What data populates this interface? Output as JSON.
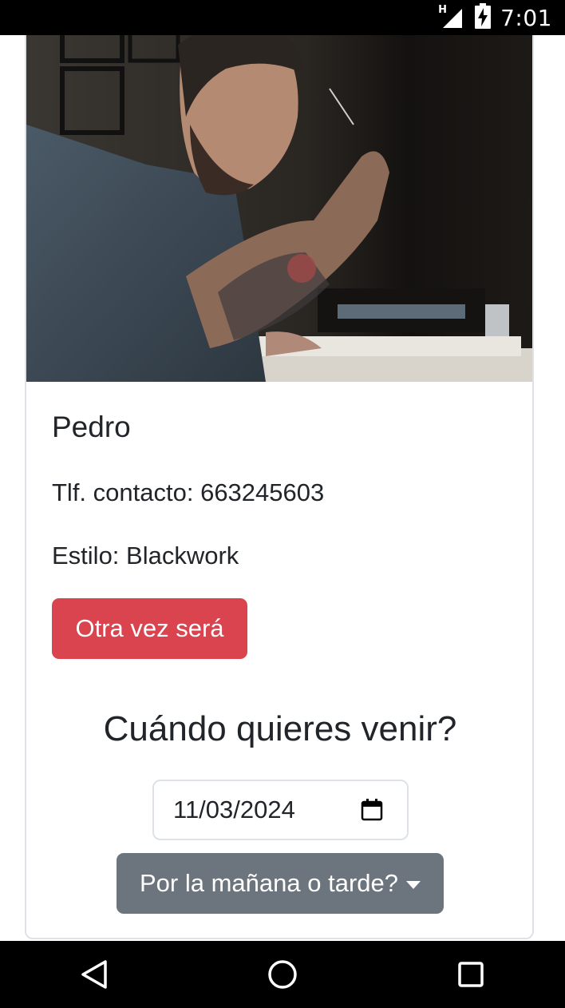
{
  "status_bar": {
    "network_type": "H",
    "time": "7:01",
    "icons": [
      "signal-icon",
      "battery-charging-icon"
    ]
  },
  "card": {
    "image_alt": "tattoo-artist-photo",
    "name": "Pedro",
    "phone": "Tlf. contacto: 663245603",
    "style": "Estilo: Blackwork",
    "cancel_button": "Otra vez será",
    "question": "Cuándo quieres venir?",
    "date_value": "11/03/2024",
    "dropdown_label": "Por la mañana o tarde?"
  },
  "colors": {
    "danger": "#d9444f",
    "secondary": "#6c757d",
    "text": "#212529",
    "border": "#dee2e6"
  },
  "nav_bar": {
    "icons": [
      "back-icon",
      "home-icon",
      "recents-icon"
    ]
  }
}
